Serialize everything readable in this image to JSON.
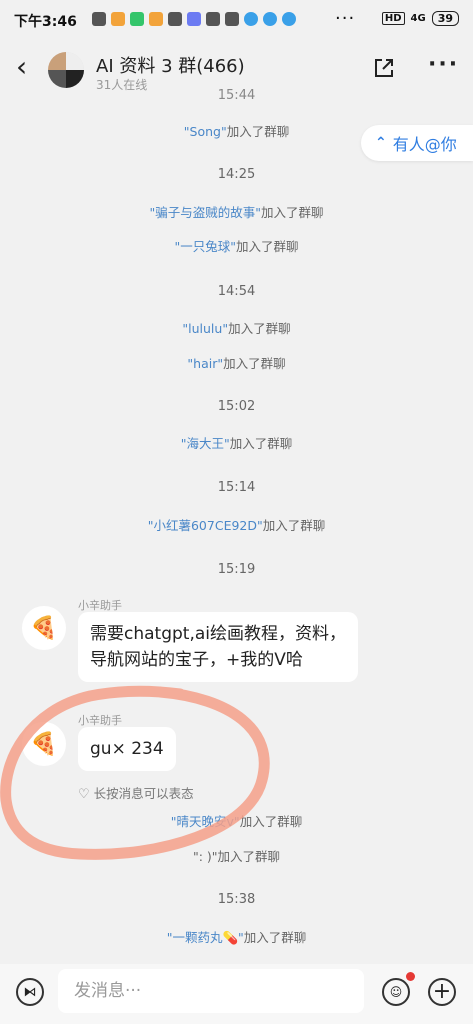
{
  "status": {
    "time": "下午3:46",
    "hd": "HD",
    "signal": "4G",
    "battery": "39",
    "dots": "···"
  },
  "header": {
    "back_icon": "chevron-left-icon",
    "title": "AI 资料 3 群(466)",
    "subtitle": "31人在线",
    "share_icon": "external-link-icon",
    "more_label": "···"
  },
  "mention": {
    "label": "有人@你",
    "icon": "double-chevron-up-icon"
  },
  "timeline": [
    {
      "type": "time",
      "text": "15:44"
    },
    {
      "type": "sys",
      "nick": "\"Song\"",
      "suffix": "加入了群聊"
    },
    {
      "type": "time",
      "text": "14:25"
    },
    {
      "type": "sys",
      "nick": "\"骗子与盗贼的故事\"",
      "suffix": "加入了群聊"
    },
    {
      "type": "sys",
      "nick": "\"一只兔球\"",
      "suffix": "加入了群聊"
    },
    {
      "type": "time",
      "text": "14:54"
    },
    {
      "type": "sys",
      "nick": "\"lululu\"",
      "suffix": "加入了群聊"
    },
    {
      "type": "sys",
      "nick": "\"hair\"",
      "suffix": "加入了群聊"
    },
    {
      "type": "time",
      "text": "15:02"
    },
    {
      "type": "sys",
      "nick": "\"海大王\"",
      "suffix": "加入了群聊"
    },
    {
      "type": "time",
      "text": "15:14"
    },
    {
      "type": "sys",
      "nick": "\"小红薯607CE92D\"",
      "suffix": "加入了群聊"
    },
    {
      "type": "time",
      "text": "15:19"
    }
  ],
  "messages": [
    {
      "sender": "小辛助手",
      "avatar_icon": "pizza-icon",
      "text_line1": "需要chatgpt,ai绘画教程，资料，",
      "text_line2": "导航网站的宝子，+我的V哈"
    },
    {
      "sender": "小辛助手",
      "avatar_icon": "pizza-icon",
      "text": "gu×  234"
    }
  ],
  "react_hint": "长按消息可以表态",
  "timeline2": [
    {
      "type": "sys",
      "nick": "\"晴天晚安v\"",
      "suffix": "加入了群聊"
    },
    {
      "type": "sys",
      "nick": "\": )\"",
      "suffix": "加入了群聊"
    },
    {
      "type": "time",
      "text": "15:38"
    },
    {
      "type": "sys",
      "nick": "\"一颗药丸💊\"",
      "suffix": "加入了群聊"
    }
  ],
  "input": {
    "placeholder": "发消息···",
    "voice_icon": "voice-icon",
    "emoji_icon": "emoji-icon",
    "plus_icon": "plus-icon"
  },
  "colors": {
    "accent": "#2f7de1",
    "nick": "#4a87c8",
    "annotation": "#f4a08a"
  }
}
